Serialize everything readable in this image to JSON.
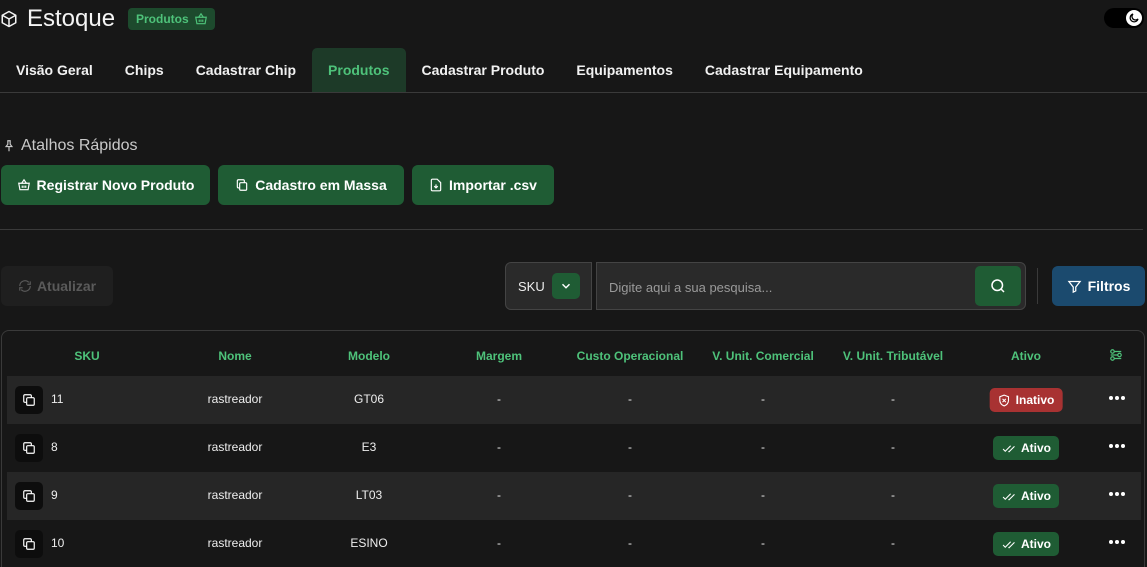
{
  "header": {
    "title": "Estoque",
    "badge": "Produtos",
    "logo_icon": "box-icon",
    "badge_icon": "basket-icon",
    "theme_icon": "moon-icon"
  },
  "tabs": [
    {
      "label": "Visão Geral",
      "active": false
    },
    {
      "label": "Chips",
      "active": false
    },
    {
      "label": "Cadastrar Chip",
      "active": false
    },
    {
      "label": "Produtos",
      "active": true
    },
    {
      "label": "Cadastrar Produto",
      "active": false
    },
    {
      "label": "Equipamentos",
      "active": false
    },
    {
      "label": "Cadastrar Equipamento",
      "active": false
    }
  ],
  "shortcuts": {
    "title": "Atalhos Rápidos",
    "register_label": "Registrar Novo Produto",
    "bulk_label": "Cadastro em Massa",
    "import_label": "Importar .csv"
  },
  "toolbar": {
    "refresh_label": "Atualizar",
    "search_field": "SKU",
    "search_placeholder": "Digite aqui a sua pesquisa...",
    "filters_label": "Filtros"
  },
  "table": {
    "columns": {
      "sku": "SKU",
      "name": "Nome",
      "model": "Modelo",
      "margin": "Margem",
      "op_cost": "Custo Operacional",
      "unit_commercial": "V. Unit. Comercial",
      "unit_tax": "V. Unit. Tributável",
      "active": "Ativo"
    },
    "rows": [
      {
        "sku": "11",
        "name": "rastreador",
        "model": "GT06",
        "margin": "-",
        "op_cost": "-",
        "unit_commercial": "-",
        "unit_tax": "-",
        "status": "Inativo"
      },
      {
        "sku": "8",
        "name": "rastreador",
        "model": "E3",
        "margin": "-",
        "op_cost": "-",
        "unit_commercial": "-",
        "unit_tax": "-",
        "status": "Ativo"
      },
      {
        "sku": "9",
        "name": "rastreador",
        "model": "LT03",
        "margin": "-",
        "op_cost": "-",
        "unit_commercial": "-",
        "unit_tax": "-",
        "status": "Ativo"
      },
      {
        "sku": "10",
        "name": "rastreador",
        "model": "ESINO",
        "margin": "-",
        "op_cost": "-",
        "unit_commercial": "-",
        "unit_tax": "-",
        "status": "Ativo"
      }
    ]
  },
  "colors": {
    "background": "#171717",
    "accent_green": "#4ec27a",
    "button_green": "#1f5c34",
    "filter_blue": "#1b4a6e",
    "inactive_red": "#a83232"
  }
}
